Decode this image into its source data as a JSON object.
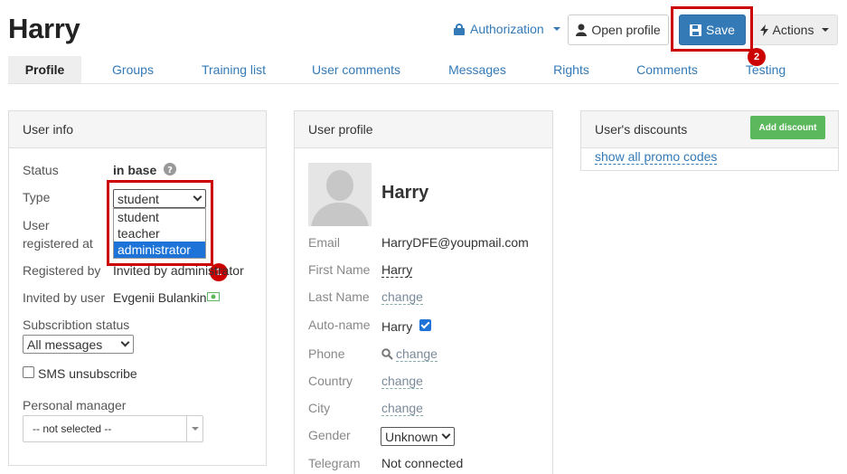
{
  "header": {
    "title": "Harry",
    "authorization_label": "Authorization",
    "open_profile_label": "Open profile",
    "save_label": "Save",
    "actions_label": "Actions"
  },
  "annotations": {
    "badge1": "1",
    "badge2": "2"
  },
  "tabs": [
    {
      "label": "Profile",
      "active": true
    },
    {
      "label": "Groups"
    },
    {
      "label": "Training list"
    },
    {
      "label": "User comments"
    },
    {
      "label": "Messages"
    },
    {
      "label": "Rights"
    },
    {
      "label": "Comments"
    },
    {
      "label": "Testing"
    }
  ],
  "user_info": {
    "heading": "User info",
    "status_label": "Status",
    "status_value": "in base",
    "type_label": "Type",
    "type_value": "student",
    "type_options": [
      "student",
      "teacher",
      "administrator"
    ],
    "registered_label_1": "User",
    "registered_label_2": "registered at",
    "registered_by_label": "Registered by",
    "registered_by_value": "Invited by administrator",
    "invited_by_label": "Invited by user",
    "invited_by_value": "Evgenii Bulankin",
    "subscription_label": "Subscribtion status",
    "subscription_value": "All messages",
    "sms_label": "SMS unsubscribe",
    "manager_label": "Personal manager",
    "manager_value": "-- not selected --"
  },
  "user_profile": {
    "heading": "User profile",
    "name": "Harry",
    "email_label": "Email",
    "email_value": "HarryDFE@youpmail.com",
    "first_name_label": "First Name",
    "first_name_value": "Harry",
    "last_name_label": "Last Name",
    "last_name_value": "change",
    "auto_name_label": "Auto-name",
    "auto_name_value": "Harry",
    "phone_label": "Phone",
    "phone_value": "change",
    "country_label": "Country",
    "country_value": "change",
    "city_label": "City",
    "city_value": "change",
    "gender_label": "Gender",
    "gender_value": "Unknown",
    "telegram_label": "Telegram",
    "telegram_value": "Not connected"
  },
  "discounts": {
    "heading": "User's discounts",
    "add_label": "Add discount",
    "promo_link": "show all promo codes"
  },
  "colors": {
    "link": "#337ab7",
    "primary": "#337ab7",
    "highlight": "#c00",
    "success": "#5cb85c",
    "selected": "#1e73d9"
  }
}
